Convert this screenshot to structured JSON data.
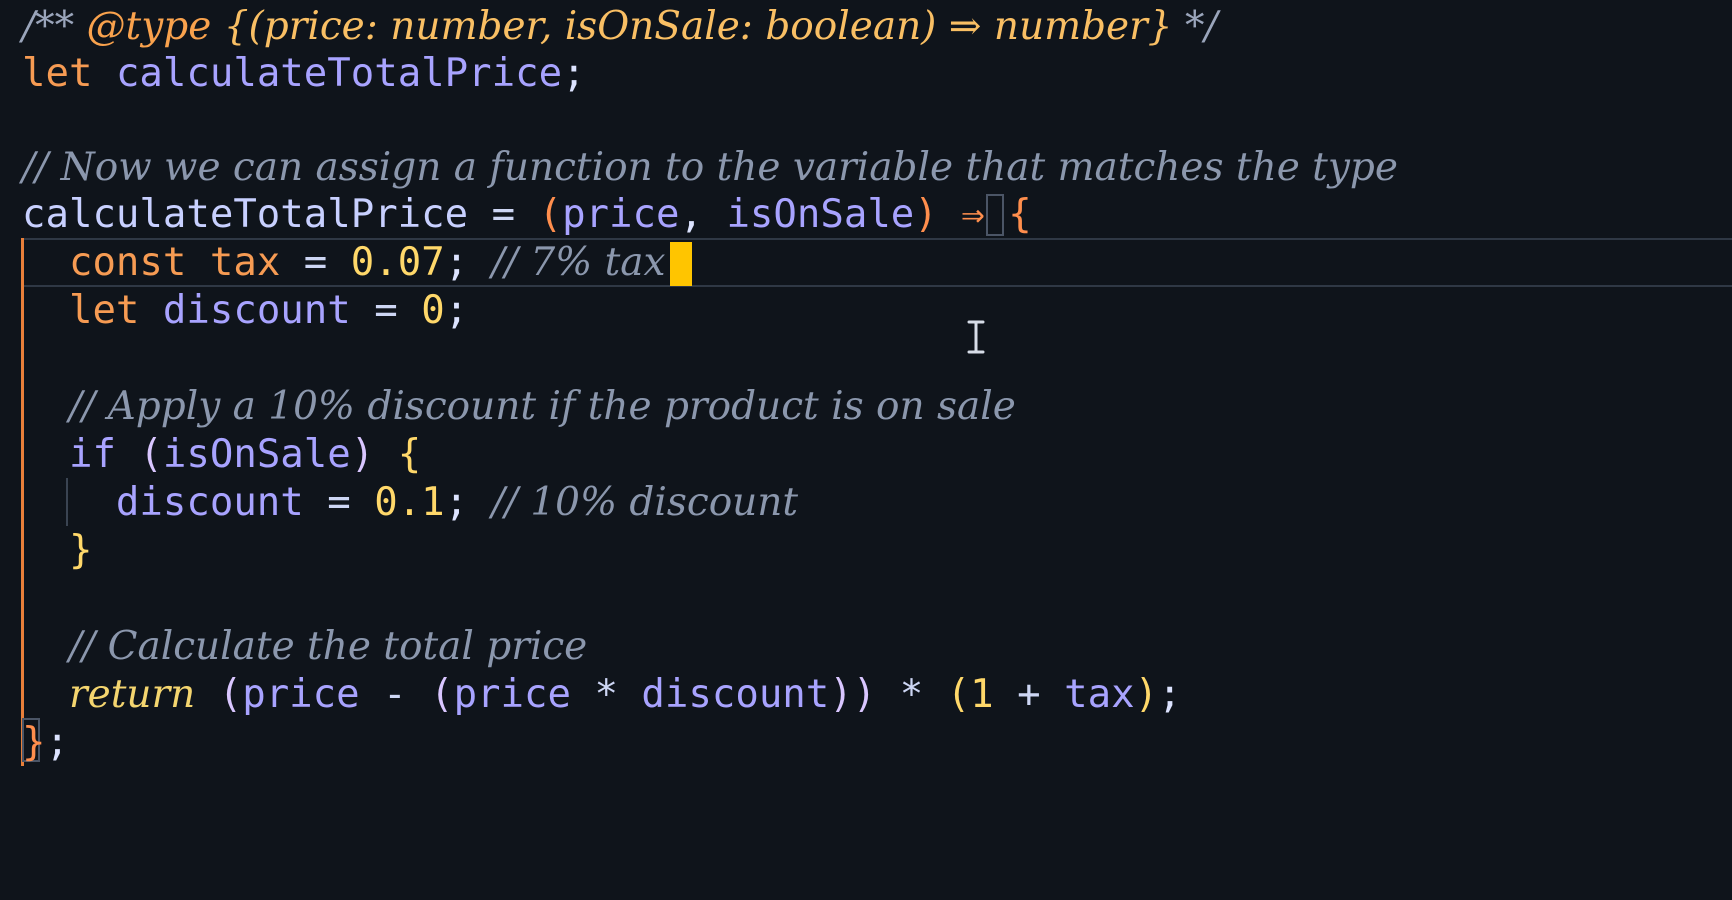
{
  "editor": {
    "theme": {
      "background": "#0f141b",
      "cursor": "#ffc500",
      "block_guide": "#e87f3a"
    },
    "lines": [
      {
        "tokens": [
          {
            "text": "/** ",
            "kind": "comment-doc"
          },
          {
            "text": "@type",
            "kind": "tag"
          },
          {
            "text": " ",
            "kind": "comment-doc"
          },
          {
            "text": "{(price: number, isOnSale: boolean) ⇒ number}",
            "kind": "type"
          },
          {
            "text": " */",
            "kind": "comment-doc"
          }
        ]
      },
      {
        "tokens": [
          {
            "text": "let",
            "kind": "kw"
          },
          {
            "text": " ",
            "kind": "op"
          },
          {
            "text": "calculateTotalPrice",
            "kind": "var"
          },
          {
            "text": ";",
            "kind": "punc"
          }
        ]
      },
      {
        "tokens": []
      },
      {
        "tokens": [
          {
            "text": "// Now we can assign a function to the variable that matches the type",
            "kind": "comment"
          }
        ]
      },
      {
        "tokens": [
          {
            "text": "calculateTotalPrice",
            "kind": "fn"
          },
          {
            "text": " = ",
            "kind": "op"
          },
          {
            "text": "(",
            "kind": "arrow"
          },
          {
            "text": "price",
            "kind": "var"
          },
          {
            "text": ", ",
            "kind": "punc"
          },
          {
            "text": "isOnSale",
            "kind": "var"
          },
          {
            "text": ")",
            "kind": "arrow"
          },
          {
            "text": " ⇒ ",
            "kind": "arrow"
          },
          {
            "text": "{",
            "kind": "arrow"
          }
        ]
      },
      {
        "tokens": [
          {
            "text": "  ",
            "kind": "op"
          },
          {
            "text": "const",
            "kind": "kw"
          },
          {
            "text": " ",
            "kind": "op"
          },
          {
            "text": "tax",
            "kind": "kw"
          },
          {
            "text": " = ",
            "kind": "op"
          },
          {
            "text": "0.07",
            "kind": "num"
          },
          {
            "text": "; ",
            "kind": "punc"
          },
          {
            "text": "// 7% tax",
            "kind": "comment"
          }
        ]
      },
      {
        "tokens": [
          {
            "text": "  ",
            "kind": "op"
          },
          {
            "text": "let",
            "kind": "kw"
          },
          {
            "text": " ",
            "kind": "op"
          },
          {
            "text": "discount",
            "kind": "var"
          },
          {
            "text": " = ",
            "kind": "op"
          },
          {
            "text": "0",
            "kind": "num"
          },
          {
            "text": ";",
            "kind": "punc"
          }
        ]
      },
      {
        "tokens": []
      },
      {
        "tokens": [
          {
            "text": "  ",
            "kind": "op"
          },
          {
            "text": "// Apply a 10% discount if the product is on sale",
            "kind": "comment"
          }
        ]
      },
      {
        "tokens": [
          {
            "text": "  ",
            "kind": "op"
          },
          {
            "text": "if",
            "kind": "kw2"
          },
          {
            "text": " ",
            "kind": "op"
          },
          {
            "text": "(",
            "kind": "paren1"
          },
          {
            "text": "isOnSale",
            "kind": "var"
          },
          {
            "text": ")",
            "kind": "paren1"
          },
          {
            "text": " ",
            "kind": "op"
          },
          {
            "text": "{",
            "kind": "paren2"
          }
        ]
      },
      {
        "tokens": [
          {
            "text": "    ",
            "kind": "op"
          },
          {
            "text": "discount",
            "kind": "var"
          },
          {
            "text": " = ",
            "kind": "op"
          },
          {
            "text": "0.1",
            "kind": "num"
          },
          {
            "text": "; ",
            "kind": "punc"
          },
          {
            "text": "// 10% discount",
            "kind": "comment"
          }
        ]
      },
      {
        "tokens": [
          {
            "text": "  ",
            "kind": "op"
          },
          {
            "text": "}",
            "kind": "paren2"
          }
        ]
      },
      {
        "tokens": []
      },
      {
        "tokens": [
          {
            "text": "  ",
            "kind": "op"
          },
          {
            "text": "// Calculate the total price",
            "kind": "comment"
          }
        ]
      },
      {
        "tokens": [
          {
            "text": "  ",
            "kind": "op"
          },
          {
            "text": "return",
            "kind": "ret"
          },
          {
            "text": " ",
            "kind": "op"
          },
          {
            "text": "(",
            "kind": "paren1"
          },
          {
            "text": "price",
            "kind": "var"
          },
          {
            "text": " - ",
            "kind": "op"
          },
          {
            "text": "(",
            "kind": "paren1"
          },
          {
            "text": "price",
            "kind": "var"
          },
          {
            "text": " * ",
            "kind": "op"
          },
          {
            "text": "discount",
            "kind": "var"
          },
          {
            "text": "))",
            "kind": "paren1"
          },
          {
            "text": " * ",
            "kind": "op"
          },
          {
            "text": "(",
            "kind": "paren2"
          },
          {
            "text": "1",
            "kind": "num"
          },
          {
            "text": " + ",
            "kind": "op"
          },
          {
            "text": "tax",
            "kind": "var"
          },
          {
            "text": ")",
            "kind": "paren2"
          },
          {
            "text": ";",
            "kind": "punc"
          }
        ]
      },
      {
        "tokens": [
          {
            "text": "}",
            "kind": "arrow"
          },
          {
            "text": ";",
            "kind": "punc"
          }
        ]
      }
    ]
  }
}
